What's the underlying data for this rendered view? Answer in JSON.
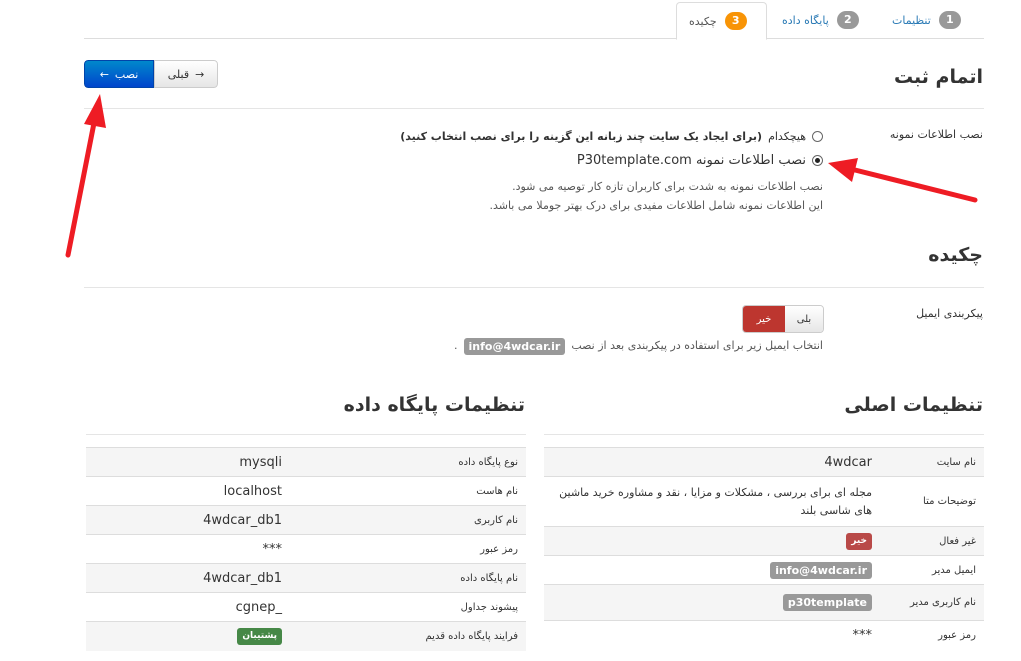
{
  "tabs": [
    {
      "num": "1",
      "label": "تنظیمات"
    },
    {
      "num": "2",
      "label": "پایگاه داده"
    },
    {
      "num": "3",
      "label": "چکیده"
    }
  ],
  "toolbar": {
    "prev_label": "قبلی",
    "install_label": "نصب"
  },
  "finish": {
    "title": "اتمام ثبت",
    "sample_label": "نصب اطلاعات نمونه",
    "option_none": "هیچکدام",
    "option_none_note": "(برای ایجاد یک سایت چند زبانه این گزینه را برای نصب انتخاب کنید)",
    "option_sample": "نصب اطلاعات نمونه P30template.com",
    "help_line1": "نصب اطلاعات نمونه به شدت برای کاربران تازه کار توصیه می شود.",
    "help_line2": "این اطلاعات نمونه شامل اطلاعات مفیدی برای درک بهتر جوملا می باشد."
  },
  "summary": {
    "title": "چکیده",
    "email_config_label": "پیکربندی ایمیل",
    "yes": "بلی",
    "no": "خیر",
    "email_help": "انتخاب ایمیل زیر برای استفاده در پیکربندی بعد از نصب",
    "email": "info@4wdcar.ir"
  },
  "main_settings": {
    "title": "تنظیمات اصلی",
    "rows": [
      {
        "key": "نام سایت",
        "value": "4wdcar"
      },
      {
        "key": "توضیحات متا",
        "value": "مجله ای برای بررسی ، مشکلات و مزایا ، نقد و مشاوره خرید ماشین های شاسی بلند"
      },
      {
        "key": "غیر فعال",
        "badge": "خیر"
      },
      {
        "key": "ایمیل مدیر",
        "badge": "info@4wdcar.ir"
      },
      {
        "key": "نام کاربری مدیر",
        "badge": "p30template"
      },
      {
        "key": "رمز عبور",
        "value": "***"
      }
    ]
  },
  "db_settings": {
    "title": "تنظیمات پایگاه داده",
    "rows": [
      {
        "key": "نوع پایگاه داده",
        "value": "mysqli"
      },
      {
        "key": "نام هاست",
        "value": "localhost"
      },
      {
        "key": "نام کاربری",
        "value": "4wdcar_db1"
      },
      {
        "key": "رمز عبور",
        "value": "***"
      },
      {
        "key": "نام پایگاه داده",
        "value": "4wdcar_db1"
      },
      {
        "key": "پیشوند جداول",
        "value": "_cgnep"
      },
      {
        "key": "فرایند پایگاه داده قدیم",
        "badge": "پشتیبان"
      }
    ]
  },
  "colors": {
    "accent": "#0066cc",
    "arrow": "#ee1c24",
    "danger": "#bd362f",
    "success": "#468847"
  }
}
